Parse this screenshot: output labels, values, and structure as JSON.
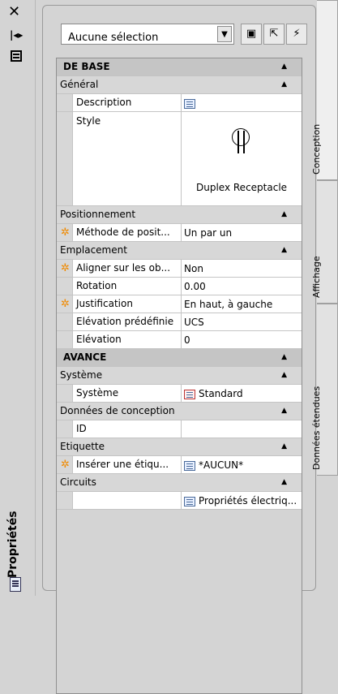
{
  "strip": {
    "title": "Propriétés"
  },
  "toolbar": {
    "selection_value": "Aucune sélection"
  },
  "categories": {
    "base": "DE BASE",
    "advanced": "AVANCE"
  },
  "sections": {
    "general": "Général",
    "positioning": "Positionnement",
    "location": "Emplacement",
    "system": "Système",
    "design_data": "Données de conception",
    "label": "Etiquette",
    "circuits": "Circuits"
  },
  "props": {
    "description": {
      "name": "Description",
      "value": ""
    },
    "style": {
      "name": "Style",
      "value": "Duplex Receptacle"
    },
    "placement_method": {
      "name": "Méthode de posit...",
      "value": "Un par un"
    },
    "align": {
      "name": "Aligner sur les ob...",
      "value": "Non"
    },
    "rotation": {
      "name": "Rotation",
      "value": "0.00"
    },
    "justification": {
      "name": "Justification",
      "value": "En haut, à gauche"
    },
    "preset_elevation": {
      "name": "Elévation prédéfinie",
      "value": "UCS"
    },
    "elevation": {
      "name": "Elévation",
      "value": "0"
    },
    "system": {
      "name": "Système",
      "value": "Standard"
    },
    "id": {
      "name": "ID",
      "value": ""
    },
    "insert_label": {
      "name": "Insérer une étiqu...",
      "value": "*AUCUN*"
    },
    "circuits": {
      "name": "",
      "value": "Propriétés électriq..."
    }
  },
  "tabs": [
    "Conception",
    "Affichage",
    "Données étendues"
  ]
}
